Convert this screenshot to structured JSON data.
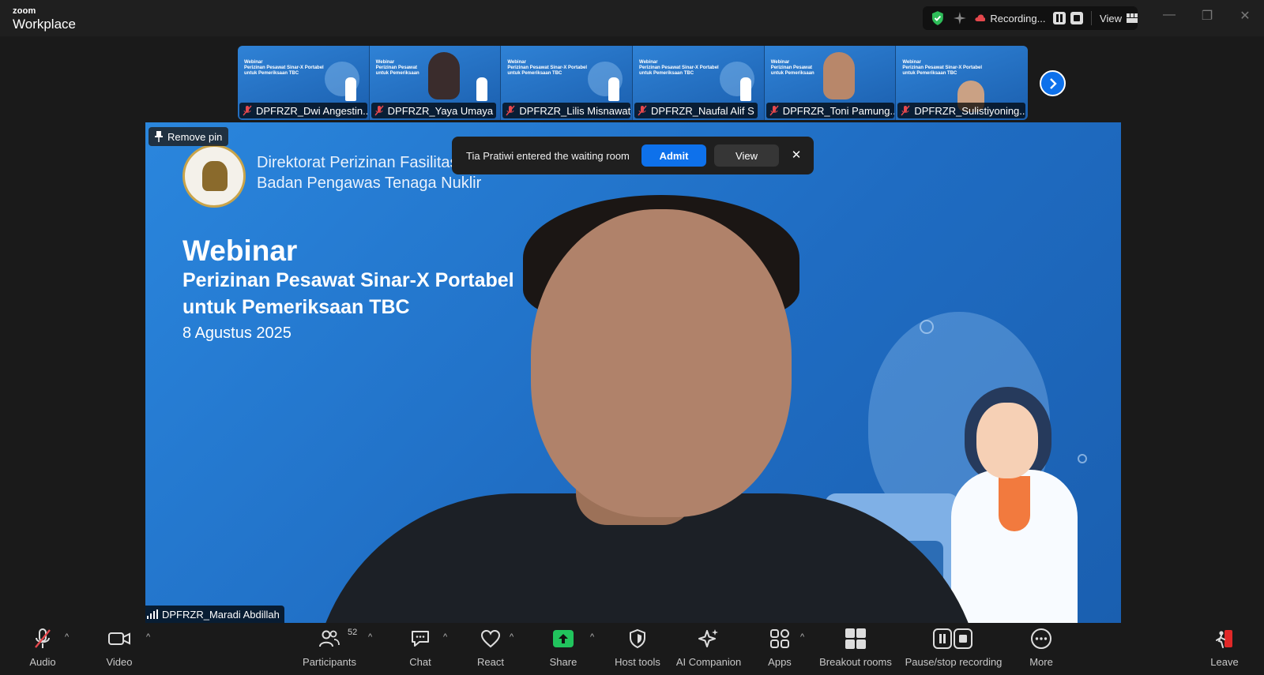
{
  "app": {
    "logo_top": "zoom",
    "logo_bottom": "Workplace"
  },
  "titlebar": {
    "recording_label": "Recording...",
    "view_label": "View",
    "icons": [
      "shield-check-icon",
      "sparkle-icon",
      "cloud-record-icon",
      "pause-icon",
      "stop-icon",
      "grid-view-icon",
      "minimize-icon",
      "restore-icon",
      "close-icon"
    ]
  },
  "participants_strip": [
    {
      "name": "DPFRZR_Dwi Angestin...",
      "muted": true,
      "video": "slide"
    },
    {
      "name": "DPFRZR_Yaya Umaya",
      "muted": true,
      "video": "camera"
    },
    {
      "name": "DPFRZR_Lilis Misnawati",
      "muted": true,
      "video": "slide"
    },
    {
      "name": "DPFRZR_Naufal Alif S",
      "muted": true,
      "video": "slide"
    },
    {
      "name": "DPFRZR_Toni Pamung...",
      "muted": true,
      "video": "camera"
    },
    {
      "name": "DPFRZR_Sulistiyoning...",
      "muted": true,
      "video": "camera"
    }
  ],
  "main_video": {
    "pin_label": "Remove pin",
    "speaker_name": "DPFRZR_Maradi Abdillah",
    "slide": {
      "org_line1": "Direktorat Perizinan Fasilitas Radiasi dan Zat Radioaktif",
      "org_line2": "Badan Pengawas Tenaga Nuklir",
      "title": "Webinar",
      "subtitle1": "Perizinan Pesawat Sinar-X Portabel",
      "subtitle2": "untuk Pemeriksaan TBC",
      "date": "8 Agustus 2025"
    }
  },
  "waiting_room_toast": {
    "message": "Tia Pratiwi entered the waiting room",
    "admit_label": "Admit",
    "view_label": "View",
    "close_symbol": "✕"
  },
  "toolbar": {
    "audio": "Audio",
    "video": "Video",
    "participants": "Participants",
    "participants_count": "52",
    "chat": "Chat",
    "react": "React",
    "share": "Share",
    "host_tools": "Host tools",
    "ai_companion": "AI Companion",
    "apps": "Apps",
    "breakout_rooms": "Breakout rooms",
    "pause_stop_recording": "Pause/stop recording",
    "more": "More",
    "leave": "Leave"
  },
  "colors": {
    "accent": "#0e71eb",
    "share_green": "#21c45d",
    "leave_red": "#e02828",
    "muted_red": "#e5484d"
  }
}
